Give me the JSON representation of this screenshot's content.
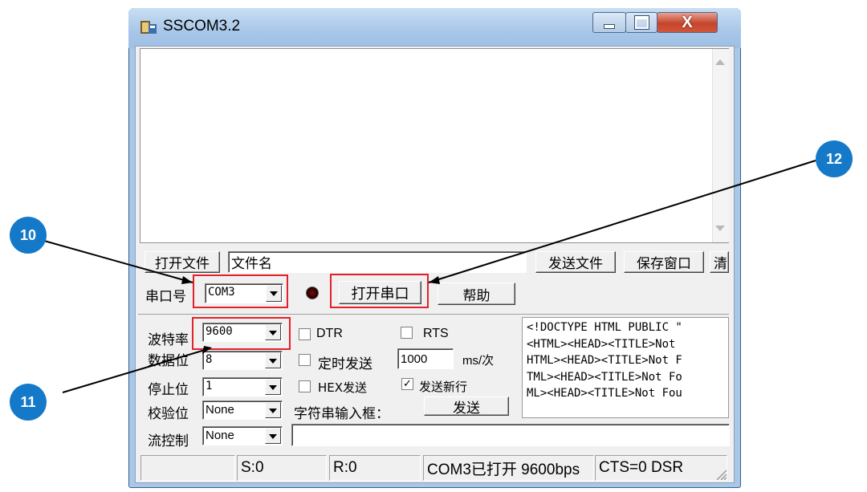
{
  "window": {
    "title": "SSCOM3.2",
    "icon": "app-icon"
  },
  "caption_buttons": {
    "minimize": "minimize-icon",
    "maximize": "maximize-icon",
    "close": "X"
  },
  "file_row": {
    "open_file": "打开文件",
    "filename": "文件名",
    "send_file": "发送文件",
    "save_window": "保存窗口",
    "clear": "清"
  },
  "port_row": {
    "port_label": "串口号",
    "port_value": "COM3",
    "open_port": "打开串口",
    "help": "帮助"
  },
  "settings": {
    "baud_label": "波特率",
    "baud_value": "9600",
    "data_bits_label": "数据位",
    "data_bits_value": "8",
    "stop_bits_label": "停止位",
    "stop_bits_value": "1",
    "parity_label": "校验位",
    "parity_value": "None",
    "flow_label": "流控制",
    "flow_value": "None"
  },
  "options": {
    "dtr": "DTR",
    "rts": "RTS",
    "timed_send": "定时发送",
    "interval_value": "1000",
    "interval_unit": "ms/次",
    "hex_send": "HEX发送",
    "send_newline": "发送新行",
    "newline_checked": "✓",
    "string_input_label": "字符串输入框：",
    "send_button": "发送"
  },
  "send_log": {
    "lines": [
      "<!DOCTYPE HTML PUBLIC \"",
      "<HTML><HEAD><TITLE>Not",
      "HTML><HEAD><TITLE>Not F",
      "TML><HEAD><TITLE>Not Fo",
      "ML><HEAD><TITLE>Not Fou"
    ]
  },
  "status_bar": {
    "blank": "",
    "sent": "S:0",
    "received": "R:0",
    "port_status": "COM3已打开  9600bps",
    "lines": "CTS=0 DSR"
  },
  "callouts": {
    "c10": "10",
    "c11": "11",
    "c12": "12"
  },
  "colors": {
    "highlight": "#e3212b",
    "callout": "#1479c9"
  }
}
